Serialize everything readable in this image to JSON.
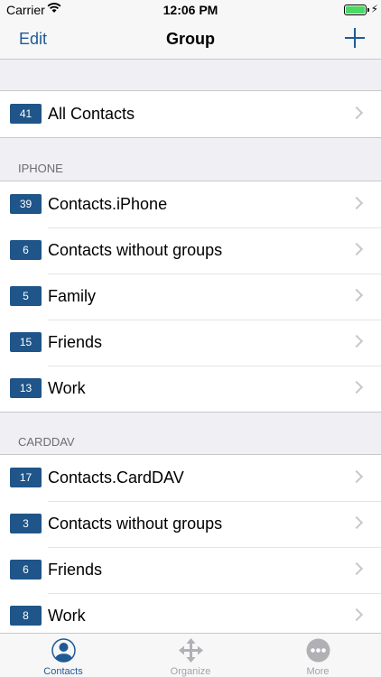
{
  "status": {
    "carrier": "Carrier",
    "time": "12:06 PM"
  },
  "nav": {
    "edit": "Edit",
    "title": "Group"
  },
  "all": {
    "count": "41",
    "label": "All Contacts"
  },
  "sections": [
    {
      "header": "IPHONE",
      "rows": [
        {
          "count": "39",
          "label": "Contacts.iPhone"
        },
        {
          "count": "6",
          "label": "Contacts without groups"
        },
        {
          "count": "5",
          "label": "Family"
        },
        {
          "count": "15",
          "label": "Friends"
        },
        {
          "count": "13",
          "label": "Work"
        }
      ]
    },
    {
      "header": "CARDDAV",
      "rows": [
        {
          "count": "17",
          "label": "Contacts.CardDAV"
        },
        {
          "count": "3",
          "label": "Contacts without groups"
        },
        {
          "count": "6",
          "label": "Friends"
        },
        {
          "count": "8",
          "label": "Work"
        }
      ]
    }
  ],
  "tabs": [
    {
      "label": "Contacts",
      "icon": "contact-icon",
      "active": true
    },
    {
      "label": "Organize",
      "icon": "move-icon",
      "active": false
    },
    {
      "label": "More",
      "icon": "more-icon",
      "active": false
    }
  ],
  "colors": {
    "accent": "#1f5a96",
    "badge": "#1f5589",
    "inactive": "#a3a3a8"
  }
}
